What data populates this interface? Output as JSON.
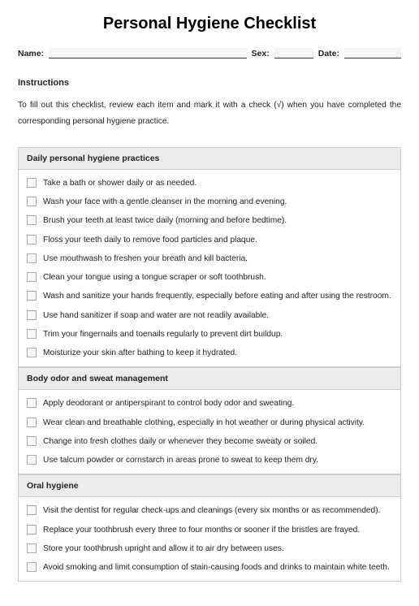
{
  "title": "Personal Hygiene Checklist",
  "form": {
    "name_label": "Name:",
    "sex_label": "Sex:",
    "date_label": "Date:"
  },
  "instructions": {
    "heading": "Instructions",
    "body": "To fill out this checklist, review each item and mark it with a check (√) when you have completed the corresponding personal hygiene practice."
  },
  "sections": [
    {
      "title": "Daily personal hygiene practices",
      "items": [
        "Take a bath or shower daily or as needed.",
        "Wash your face with a gentle cleanser in the morning and evening.",
        "Brush your teeth at least twice daily (morning and before bedtime).",
        "Floss your teeth daily to remove food particles and plaque.",
        "Use mouthwash to freshen your breath and kill bacteria.",
        "Clean your tongue using a tongue scraper or soft toothbrush.",
        "Wash and sanitize your hands frequently, especially before eating and after using the restroom.",
        "Use hand sanitizer if soap and water are not readily available.",
        "Trim your fingernails and toenails regularly to prevent dirt buildup.",
        "Moisturize your skin after bathing to keep it hydrated."
      ]
    },
    {
      "title": "Body odor and sweat management",
      "items": [
        "Apply deodorant or antiperspirant to control body odor and sweating.",
        "Wear clean and breathable clothing, especially in hot weather or during physical activity.",
        "Change into fresh clothes daily or whenever they become sweaty or soiled.",
        "Use talcum powder or cornstarch in areas prone to sweat to keep them dry."
      ]
    },
    {
      "title": "Oral hygiene",
      "items": [
        "Visit the dentist for regular check-ups and cleanings (every six months or as recommended).",
        "Replace your toothbrush every three to four months or sooner if the bristles are frayed.",
        "Store your toothbrush upright and allow it to air dry between uses.",
        "Avoid smoking and limit consumption of stain-causing foods and drinks to maintain white teeth."
      ]
    }
  ]
}
